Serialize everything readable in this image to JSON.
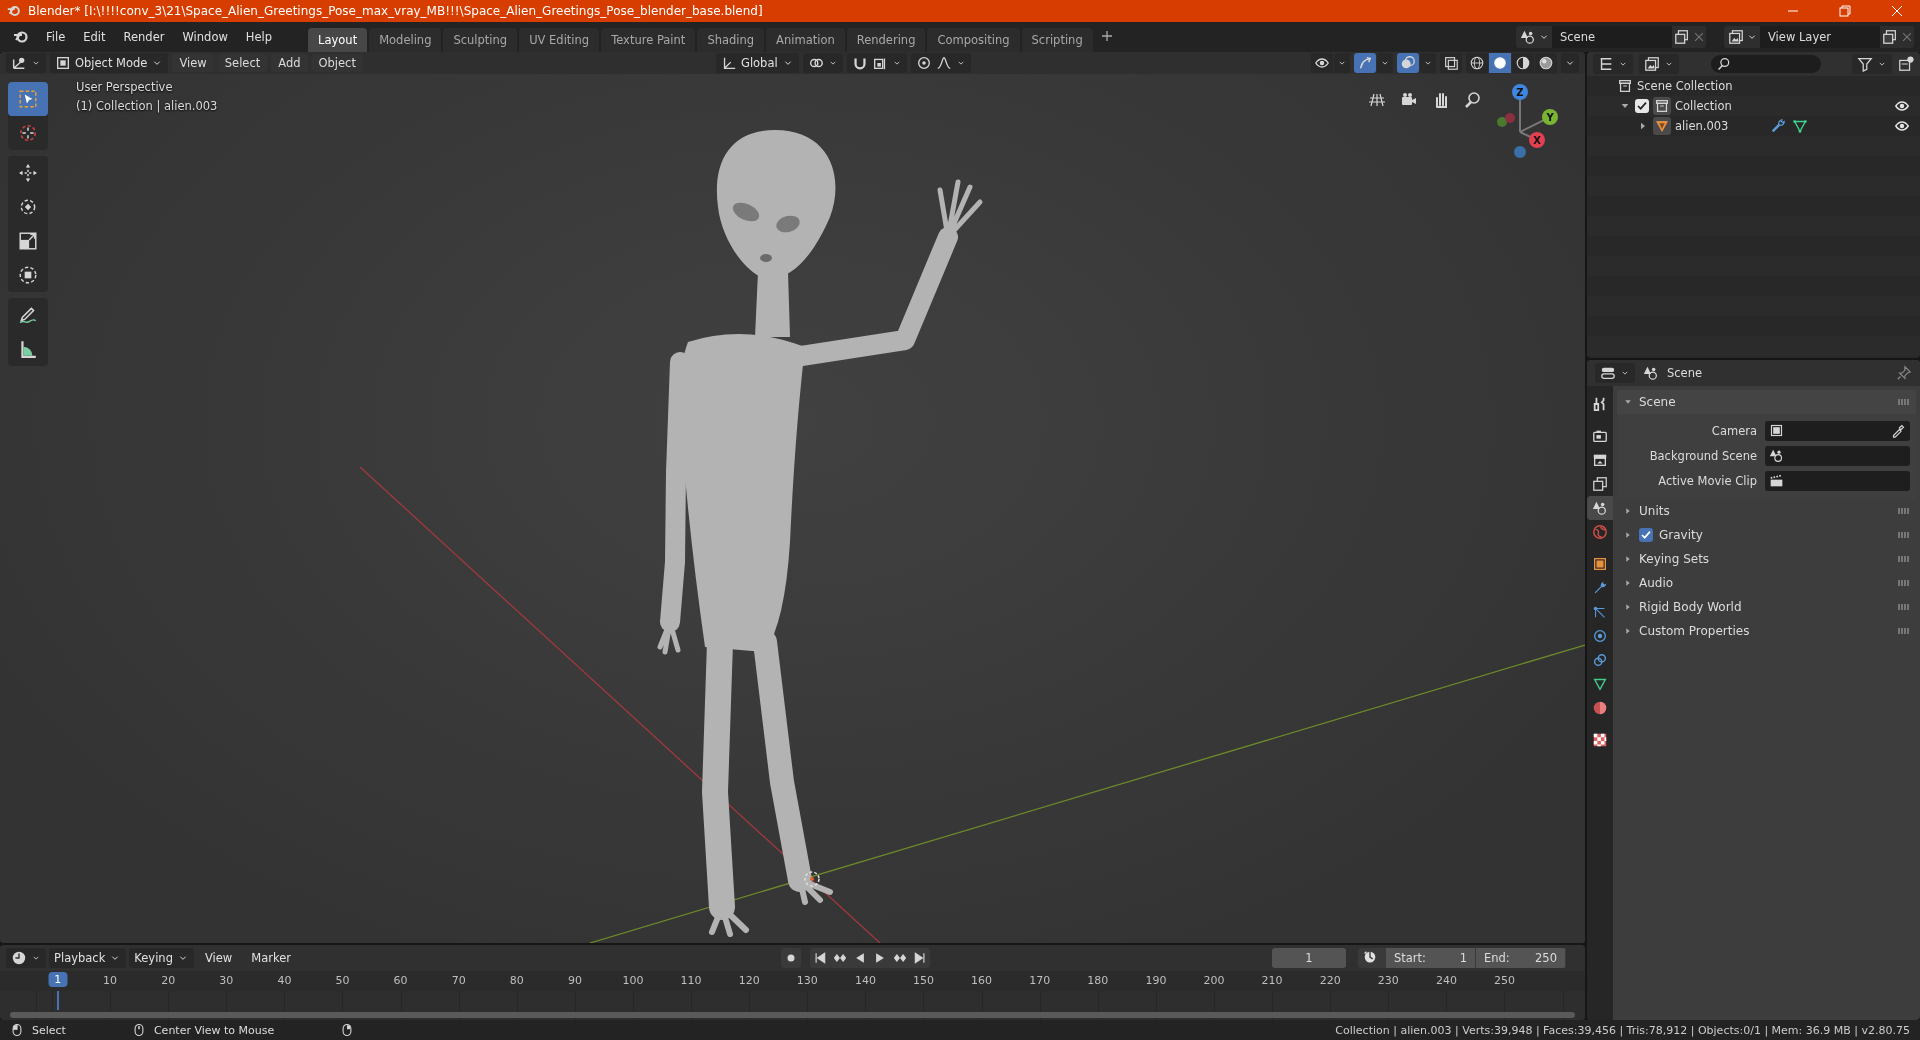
{
  "window": {
    "title": "Blender* [I:\\!!!!conv_3\\21\\Space_Alien_Greetings_Pose_max_vray_MB!!!\\Space_Alien_Greetings_Pose_blender_base.blend]"
  },
  "menu": [
    "File",
    "Edit",
    "Render",
    "Window",
    "Help"
  ],
  "workspaces": [
    {
      "label": "Layout",
      "selected": true
    },
    {
      "label": "Modeling",
      "selected": false
    },
    {
      "label": "Sculpting",
      "selected": false
    },
    {
      "label": "UV Editing",
      "selected": false
    },
    {
      "label": "Texture Paint",
      "selected": false
    },
    {
      "label": "Shading",
      "selected": false
    },
    {
      "label": "Animation",
      "selected": false
    },
    {
      "label": "Rendering",
      "selected": false
    },
    {
      "label": "Compositing",
      "selected": false
    },
    {
      "label": "Scripting",
      "selected": false
    }
  ],
  "scene_selector": {
    "value": "Scene"
  },
  "view_layer_selector": {
    "value": "View Layer"
  },
  "viewport": {
    "mode": "Object Mode",
    "menus": [
      "View",
      "Select",
      "Add",
      "Object"
    ],
    "orientation": "Global",
    "toggles": [
      {
        "kind": "visibility",
        "on": false
      },
      {
        "kind": "gizmos",
        "on": true
      },
      {
        "kind": "overlays",
        "on": true
      },
      {
        "kind": "xray",
        "on": false
      }
    ],
    "shading": [
      {
        "kind": "wireframe",
        "selected": false
      },
      {
        "kind": "solid",
        "selected": true
      },
      {
        "kind": "material",
        "selected": false
      },
      {
        "kind": "rendered",
        "selected": false
      }
    ],
    "info": [
      "User Perspective",
      "(1) Collection | alien.003"
    ],
    "tool_groups": [
      [
        {
          "kind": "select",
          "selected": true
        },
        {
          "kind": "cursor",
          "selected": false
        }
      ],
      [
        {
          "kind": "move",
          "selected": false
        },
        {
          "kind": "rotate",
          "selected": false
        },
        {
          "kind": "scale",
          "selected": false
        },
        {
          "kind": "transform",
          "selected": false
        }
      ],
      [
        {
          "kind": "annotate",
          "selected": false
        },
        {
          "kind": "measure",
          "selected": false
        }
      ]
    ],
    "gizmo_axes": [
      "Z",
      "Y",
      "X"
    ]
  },
  "outliner": {
    "items": [
      {
        "label": "Scene Collection",
        "kind": "scene_collection",
        "children": [
          {
            "label": "Collection",
            "kind": "collection",
            "expanded": true,
            "checked": true,
            "visible": true,
            "children": [
              {
                "label": "alien.003",
                "kind": "mesh",
                "expanded": false,
                "visible": true
              }
            ]
          }
        ]
      }
    ]
  },
  "properties": {
    "context": "Scene",
    "tab_groups": [
      [
        {
          "kind": "tool",
          "selected": false
        }
      ],
      [
        {
          "kind": "render",
          "selected": false
        },
        {
          "kind": "output",
          "selected": false
        },
        {
          "kind": "view_layer",
          "selected": false
        },
        {
          "kind": "scene",
          "selected": true
        },
        {
          "kind": "world",
          "selected": false
        }
      ],
      [
        {
          "kind": "object",
          "selected": false
        },
        {
          "kind": "modifier",
          "selected": false
        },
        {
          "kind": "particles",
          "selected": false
        },
        {
          "kind": "physics",
          "selected": false
        },
        {
          "kind": "constraints",
          "selected": false
        },
        {
          "kind": "data",
          "selected": false
        },
        {
          "kind": "material",
          "selected": false
        }
      ],
      [
        {
          "kind": "texture",
          "selected": false
        }
      ]
    ],
    "panel_title": "Scene",
    "panel_expanded": true,
    "fields": [
      {
        "label": "Camera",
        "kind": "camera"
      },
      {
        "label": "Background Scene",
        "kind": "scene"
      },
      {
        "label": "Active Movie Clip",
        "kind": "clip"
      }
    ],
    "subpanels": [
      {
        "label": "Units",
        "kind": "plain"
      },
      {
        "label": "Gravity",
        "kind": "checkbox",
        "checked": true
      },
      {
        "label": "Keying Sets",
        "kind": "plain"
      },
      {
        "label": "Audio",
        "kind": "plain"
      },
      {
        "label": "Rigid Body World",
        "kind": "plain"
      },
      {
        "label": "Custom Properties",
        "kind": "plain"
      }
    ]
  },
  "timeline": {
    "menus": [
      {
        "label": "Playback",
        "dropdown": true
      },
      {
        "label": "Keying",
        "dropdown": true
      },
      {
        "label": "View",
        "dropdown": false
      },
      {
        "label": "Marker",
        "dropdown": false
      }
    ],
    "current_frame": "1",
    "start_label": "Start:",
    "start": "1",
    "end_label": "End:",
    "end": "250",
    "ruler": [
      "10",
      "20",
      "30",
      "40",
      "50",
      "60",
      "70",
      "80",
      "90",
      "100",
      "110",
      "120",
      "130",
      "140",
      "150",
      "160",
      "170",
      "180",
      "190",
      "200",
      "210",
      "220",
      "230",
      "240",
      "250"
    ],
    "playhead": "1"
  },
  "status_bar": {
    "hints": [
      {
        "kind": "left",
        "label": "Select"
      },
      {
        "kind": "middle",
        "label": "Center View to Mouse"
      },
      {
        "kind": "right"
      }
    ],
    "stats": "Collection | alien.003 | Verts:39,948 | Faces:39,456 | Tris:78,912 | Objects:0/1 | Mem: 36.9 MB | v2.80.75"
  }
}
